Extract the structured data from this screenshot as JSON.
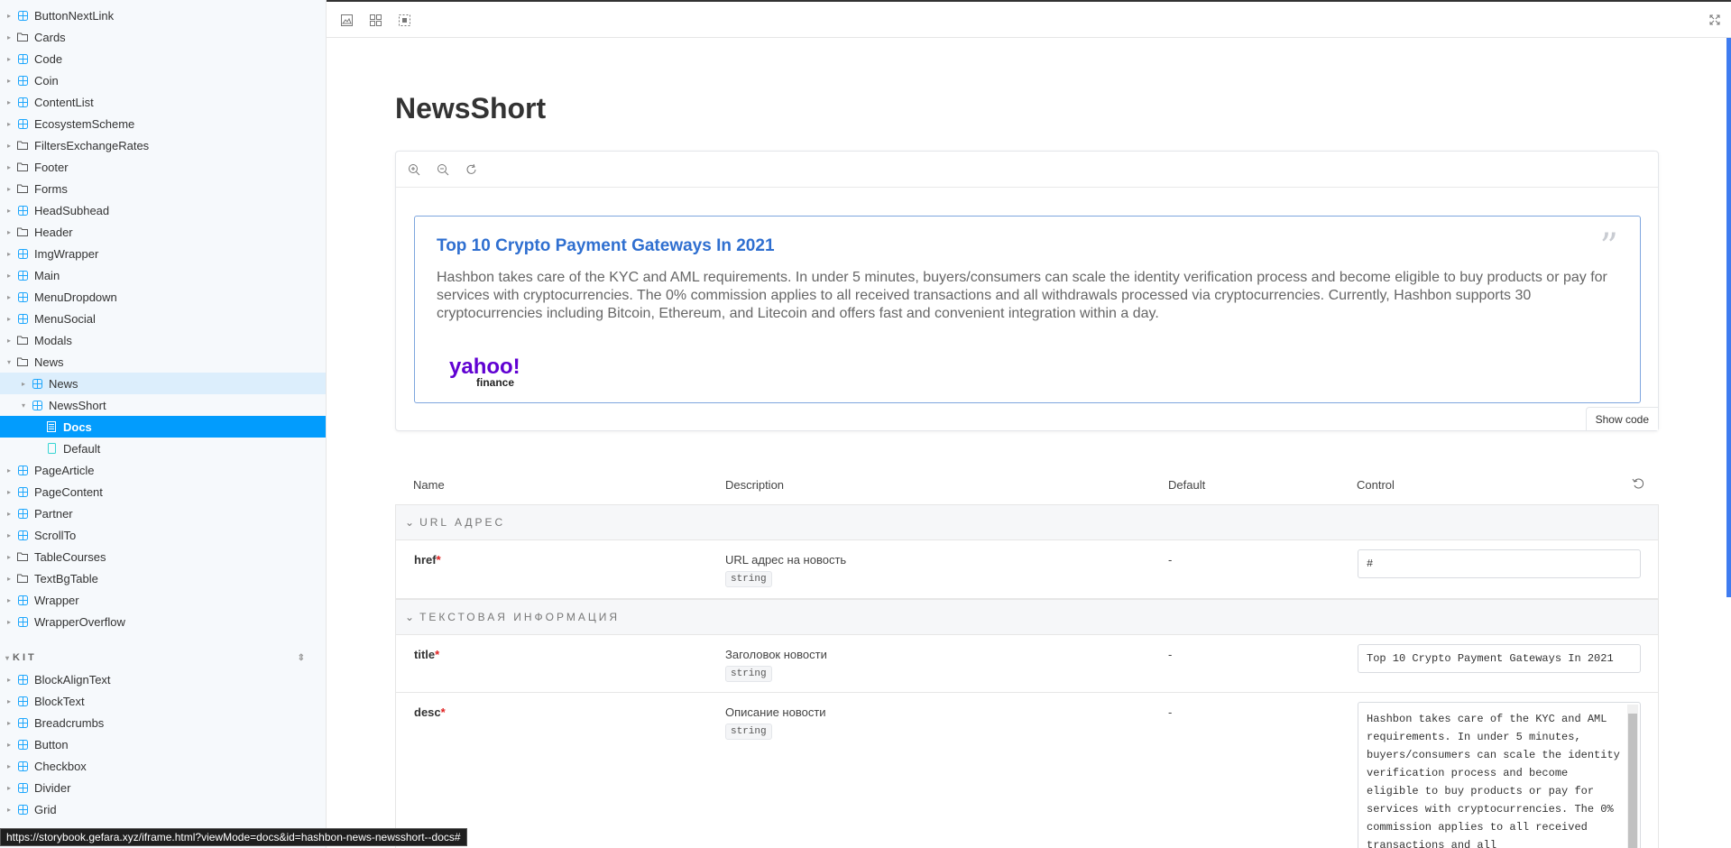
{
  "sidebar": {
    "items": [
      {
        "label": "ButtonNextLink",
        "icon": "component-icon"
      },
      {
        "label": "Cards",
        "icon": "folder-icon"
      },
      {
        "label": "Code",
        "icon": "component-icon"
      },
      {
        "label": "Coin",
        "icon": "component-icon"
      },
      {
        "label": "ContentList",
        "icon": "component-icon"
      },
      {
        "label": "EcosystemScheme",
        "icon": "component-icon"
      },
      {
        "label": "FiltersExchangeRates",
        "icon": "folder-icon"
      },
      {
        "label": "Footer",
        "icon": "folder-icon"
      },
      {
        "label": "Forms",
        "icon": "folder-icon"
      },
      {
        "label": "HeadSubhead",
        "icon": "component-icon"
      },
      {
        "label": "Header",
        "icon": "folder-icon"
      },
      {
        "label": "ImgWrapper",
        "icon": "component-icon"
      },
      {
        "label": "Main",
        "icon": "component-icon"
      },
      {
        "label": "MenuDropdown",
        "icon": "component-icon"
      },
      {
        "label": "MenuSocial",
        "icon": "component-icon"
      },
      {
        "label": "Modals",
        "icon": "folder-icon"
      },
      {
        "label": "News",
        "icon": "folder-icon"
      },
      {
        "label": "News",
        "icon": "component-icon"
      },
      {
        "label": "NewsShort",
        "icon": "component-icon"
      },
      {
        "label": "Docs",
        "icon": "document-icon"
      },
      {
        "label": "Default",
        "icon": "story-icon"
      },
      {
        "label": "PageArticle",
        "icon": "component-icon"
      },
      {
        "label": "PageContent",
        "icon": "component-icon"
      },
      {
        "label": "Partner",
        "icon": "component-icon"
      },
      {
        "label": "ScrollTo",
        "icon": "component-icon"
      },
      {
        "label": "TableCourses",
        "icon": "folder-icon"
      },
      {
        "label": "TextBgTable",
        "icon": "folder-icon"
      },
      {
        "label": "Wrapper",
        "icon": "component-icon"
      },
      {
        "label": "WrapperOverflow",
        "icon": "component-icon"
      }
    ],
    "kit_header": "KIT",
    "kit_items": [
      {
        "label": "BlockAlignText"
      },
      {
        "label": "BlockText"
      },
      {
        "label": "Breadcrumbs"
      },
      {
        "label": "Button"
      },
      {
        "label": "Checkbox"
      },
      {
        "label": "Divider"
      },
      {
        "label": "Grid"
      }
    ]
  },
  "page": {
    "title": "NewsShort"
  },
  "preview": {
    "news_title": "Top 10 Crypto Payment Gateways In 2021",
    "news_desc": "Hashbon takes care of the KYC and AML requirements. In under 5 minutes, buyers/consumers can scale the identity verification process and become eligible to buy products or pay for services with cryptocurrencies. The 0% commission applies to all received transactions and all withdrawals processed via cryptocurrencies. Currently, Hashbon supports 30 cryptocurrencies including Bitcoin, Ethereum, and Litecoin and offers fast and convenient integration within a day.",
    "logo_text": "yahoo!",
    "logo_sub": "finance",
    "show_code_label": "Show code"
  },
  "args_table": {
    "headers": {
      "name": "Name",
      "description": "Description",
      "default": "Default",
      "control": "Control"
    },
    "groups": [
      {
        "label": "URL АДРЕС"
      },
      {
        "label": "ТЕКСТОВАЯ ИНФОРМАЦИЯ"
      }
    ],
    "rows": [
      {
        "name": "href",
        "required": "*",
        "desc": "URL адрес на новость",
        "type": "string",
        "default": "-",
        "value": "#"
      },
      {
        "name": "title",
        "required": "*",
        "desc": "Заголовок новости",
        "type": "string",
        "default": "-",
        "value": "Top 10 Crypto Payment Gateways In 2021"
      },
      {
        "name": "desc",
        "required": "*",
        "desc": "Описание новости",
        "type": "string",
        "default": "-",
        "value": "Hashbon takes care of the KYC and AML requirements. In under 5 minutes, buyers/consumers can scale the identity verification process and become eligible to buy products or pay for services with cryptocurrencies. The 0% commission applies to all received transactions and all"
      }
    ]
  },
  "status_bar": {
    "url": "https://storybook.gefara.xyz/iframe.html?viewMode=docs&id=hashbon-news-newsshort--docs#"
  },
  "colors": {
    "selected": "#029cfd",
    "selected_light": "#dceefc",
    "news_title": "#2f6fd0",
    "yahoo_purple": "#6001d2"
  }
}
